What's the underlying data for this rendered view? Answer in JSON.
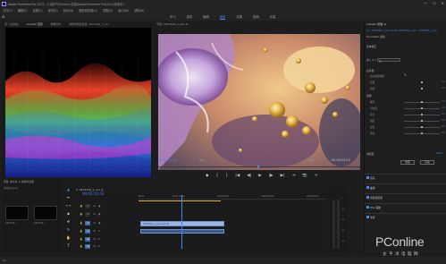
{
  "titlebar": {
    "title": "Adobe Premiere Pro 2022 - C:\\用户\\PConline\\文档\\Adobe\\Premiere Pro\\24.0\\未命名 *",
    "min": "—",
    "max": "☐",
    "close": "✕"
  },
  "menu": [
    "文件(F)",
    "编辑(E)",
    "剪辑(C)",
    "序列(S)",
    "标记(M)",
    "图形和标题(G)",
    "视图(V)",
    "窗口(W)",
    "帮助(H)"
  ],
  "workspace": {
    "tabs": [
      "学习",
      "组件",
      "编辑",
      "颜色",
      "效果",
      "音频",
      "字幕"
    ],
    "active_index": 3
  },
  "scope": {
    "tabs": [
      "源: (无剪辑)",
      "Lumetri 范围",
      "效果控件",
      "音频剪辑混合器: 1870316_1_xxx"
    ],
    "active_index": 1
  },
  "program": {
    "header": "节目: 1870316_1_xxx ≡",
    "timecode_left": "00:01:11:03",
    "fit": "适合",
    "full": "完整",
    "timecode_right": "00:03:13:23",
    "playhead_fraction": 0.49,
    "transport": [
      "◆",
      "{",
      "}",
      "|◀",
      "◀|",
      "▶",
      "|▶",
      "▶|",
      "⇥",
      "📷",
      "+"
    ]
  },
  "lumetri": {
    "title": "Lumetri 颜色 ≡",
    "source": "主 * 1870316_1_xxx.mp4 ▸ 1870316_1_xxx · 1870316_1_xxx",
    "effect": "fx  Lumetri 颜色",
    "basic_correction": "基本校正",
    "input_lut_label": "输入 LUT",
    "input_lut_value": "无",
    "white_balance": "白平衡",
    "wb_selector": "白平衡选择器",
    "tone": "色调",
    "sliders": [
      {
        "label": "色温",
        "value": "0.0",
        "pos": 0.5
      },
      {
        "label": "色彩",
        "value": "0.0",
        "pos": 0.5
      },
      {
        "label": "曝光",
        "value": "0.0",
        "pos": 0.5
      },
      {
        "label": "对比度",
        "value": "0.0",
        "pos": 0.5
      },
      {
        "label": "高光",
        "value": "0.0",
        "pos": 0.5
      },
      {
        "label": "阴影",
        "value": "0.0",
        "pos": 0.5
      },
      {
        "label": "白色",
        "value": "0.0",
        "pos": 0.5
      },
      {
        "label": "黑色",
        "value": "0.0",
        "pos": 0.5
      }
    ],
    "saturation": "饱和度",
    "saturation_value": "100.0",
    "reset_label": "重置",
    "auto_label": "自动",
    "sections": [
      "创意",
      "曲线",
      "色轮和匹配",
      "HSL 辅助",
      "晕影"
    ]
  },
  "project": {
    "tabs": "项目: 未命名 ≡  媒体浏览器",
    "file": "未命名.prproj",
    "thumbs": [
      {
        "label": "1870316_..."
      },
      {
        "label": "1870316_..."
      }
    ]
  },
  "tools": [
    "▲",
    "⇹",
    "⟷",
    "◆",
    "✥",
    "✎",
    "✋",
    "T"
  ],
  "timeline": {
    "header": "✕ 1870316_1_xxx ≡",
    "timecode": "00:01:11:03",
    "ruler": [
      "00:00",
      "00:01:00:00",
      "00:02:00:00",
      "00:03:00:00",
      "00:04:00:00"
    ],
    "tracks": [
      {
        "name": "V3",
        "on": false
      },
      {
        "name": "V2",
        "on": false
      },
      {
        "name": "V1",
        "on": true
      },
      {
        "name": "A1",
        "on": true
      },
      {
        "name": "A2",
        "on": true
      },
      {
        "name": "A3",
        "on": true
      }
    ],
    "video_clip": "1870316_1_xxx.mp4 [V]",
    "playhead_fraction": 0.23
  },
  "meters": {
    "scale": [
      "0",
      "-12",
      "-24",
      "-36",
      "-48"
    ]
  },
  "watermark": {
    "main": "PConline",
    "sub": "太平洋电脑网"
  }
}
